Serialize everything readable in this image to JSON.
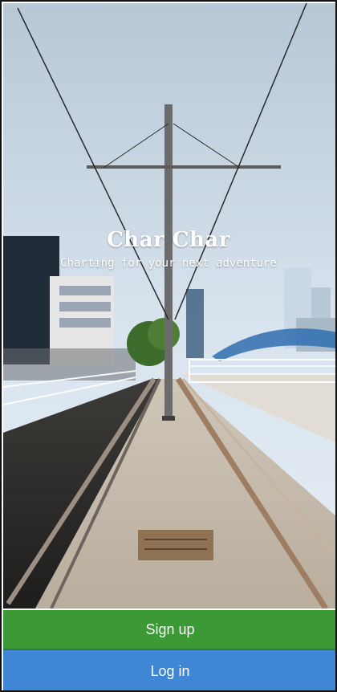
{
  "hero": {
    "title": "Char Char",
    "subtitle": "Charting for your next adventure"
  },
  "actions": {
    "signup_label": "Sign up",
    "login_label": "Log in"
  },
  "colors": {
    "signup": "#3c9a36",
    "login": "#3f86d4",
    "text": "#ffffff"
  }
}
